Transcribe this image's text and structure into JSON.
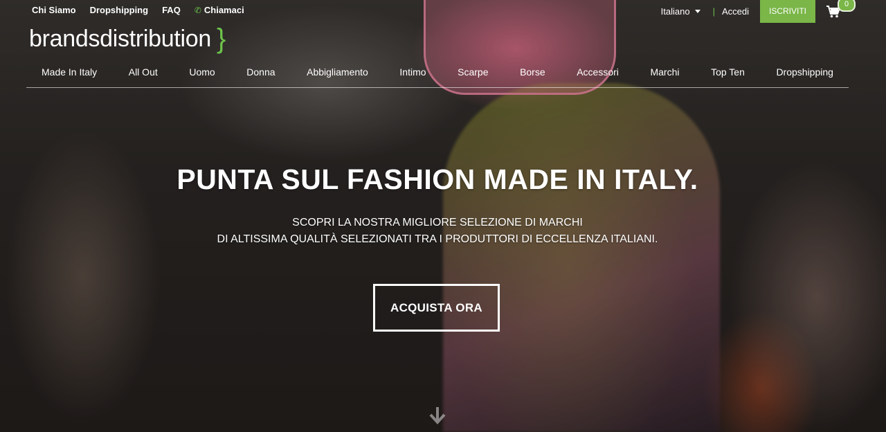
{
  "topbar": {
    "links": [
      "Chi Siamo",
      "Dropshipping",
      "FAQ",
      "Chiamaci"
    ],
    "language": "Italiano",
    "login": "Accedi",
    "signup": "ISCRIVITI",
    "cart_count": "0"
  },
  "logo": {
    "text": "brandsdistribution",
    "brace": "}"
  },
  "nav": {
    "items": [
      "Made In Italy",
      "All Out",
      "Uomo",
      "Donna",
      "Abbigliamento",
      "Intimo",
      "Scarpe",
      "Borse",
      "Accessori",
      "Marchi",
      "Top Ten",
      "Dropshipping"
    ]
  },
  "hero": {
    "headline": "PUNTA SUL FASHION MADE IN ITALY.",
    "sub_line1": "SCOPRI LA NOSTRA MIGLIORE SELEZIONE DI MARCHI",
    "sub_line2": "DI ALTISSIMA QUALITÀ SELEZIONATI TRA I PRODUTTORI DI ECCELLENZA ITALIANI.",
    "cta": "ACQUISTA ORA"
  },
  "colors": {
    "accent_green": "#7ab648",
    "icon_green": "#6cc24a"
  },
  "icons": {
    "phone": "phone-icon",
    "cart": "cart-icon",
    "caret": "chevron-down-icon",
    "scroll": "arrow-down-icon"
  }
}
